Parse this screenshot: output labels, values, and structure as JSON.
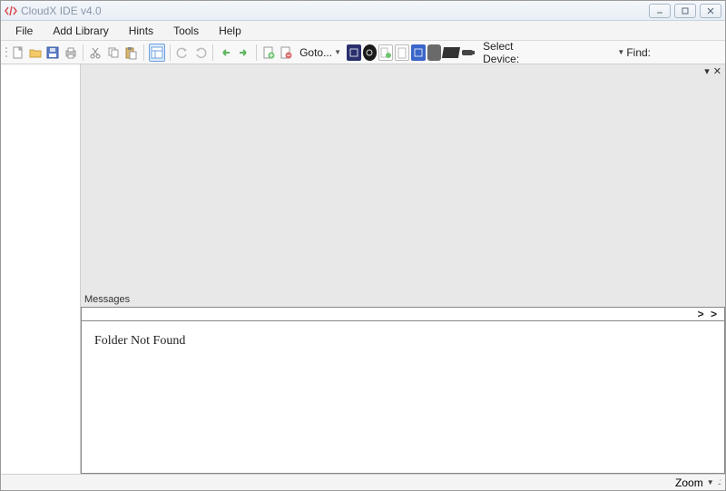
{
  "titlebar": {
    "title": "CloudX IDE v4.0"
  },
  "menu": {
    "file": "File",
    "add_library": "Add Library",
    "hints": "Hints",
    "tools": "Tools",
    "help": "Help"
  },
  "toolbar": {
    "goto_label": "Goto...",
    "select_device_label": "Select Device:",
    "find_label": "Find:"
  },
  "panels": {
    "messages_label": "Messages",
    "messages_nav": "> >",
    "messages_content": "Folder Not Found"
  },
  "statusbar": {
    "zoom_label": "Zoom"
  }
}
